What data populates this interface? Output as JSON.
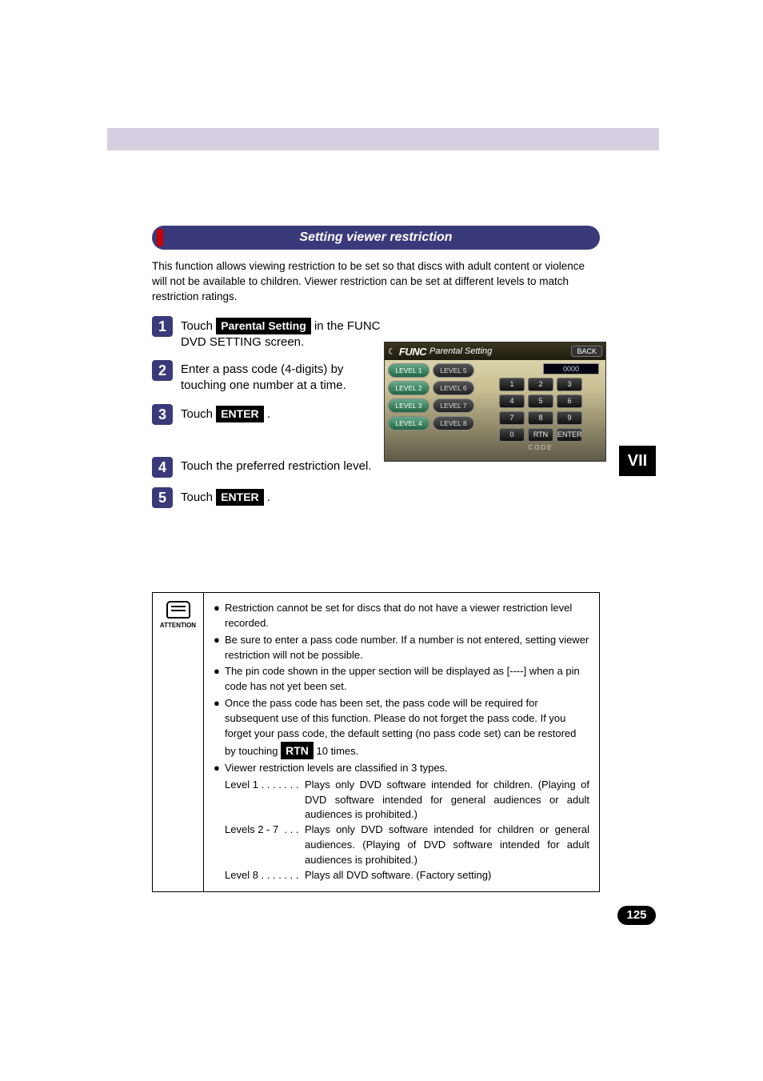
{
  "section_title": "Setting viewer restriction",
  "intro": "This function allows viewing restriction to be set so that discs with adult content or violence will not be available to children. Viewer restriction can be set at different levels to match restriction ratings.",
  "steps": {
    "s1_pre": "Touch ",
    "s1_btn": "Parental Setting",
    "s1_post": " in the FUNC DVD SETTING screen.",
    "s2": "Enter a pass code (4-digits) by touching one number at a time.",
    "s3_pre": "Touch ",
    "s3_btn": "ENTER",
    "s3_post": " .",
    "s4": "Touch the preferred restriction level.",
    "s5_pre": "Touch ",
    "s5_btn": "ENTER",
    "s5_post": " ."
  },
  "ui": {
    "func": "FUNC",
    "title": "Parental Setting",
    "back": "BACK",
    "code_value": "0000",
    "levels_a": [
      "LEVEL 1",
      "LEVEL 2",
      "LEVEL 3",
      "LEVEL 4"
    ],
    "levels_b": [
      "LEVEL 5",
      "LEVEL 6",
      "LEVEL 7",
      "LEVEL 8"
    ],
    "keys": [
      "1",
      "2",
      "3",
      "4",
      "5",
      "6",
      "7",
      "8",
      "9",
      "0",
      "RTN",
      "ENTER"
    ],
    "code_label": "CODE"
  },
  "side_tab": "VII",
  "attention_label": "ATTENTION",
  "attention": {
    "b1": "Restriction cannot be set for discs that do not have a viewer restriction level recorded.",
    "b2": "Be sure to enter a pass code number. If a number is not entered, setting viewer restriction will not be possible.",
    "b3": "The pin code shown in the upper section will be displayed as [----] when a pin code has not yet been set.",
    "b4_pre": "Once the pass code has been set, the pass code will be required for subsequent use of this function. Please do not forget the pass code. If you forget your pass code, the default setting (no pass code set) can be restored by touching ",
    "b4_btn": "RTN",
    "b4_post": " 10 times.",
    "b5": "Viewer restriction levels are classified in 3 types.",
    "l1_label": "Level 1 . . . . . . .",
    "l1_desc": "Plays only DVD software intended for children. (Playing of DVD software intended for general audiences or adult audiences is prohibited.)",
    "l2_label": "Levels 2 - 7  . . .",
    "l2_desc": "Plays only DVD software intended for children or general audiences. (Playing of DVD software intended for adult audiences is prohibited.)",
    "l3_label": "Level 8 . . . . . . .",
    "l3_desc": "Plays all DVD software. (Factory setting)"
  },
  "page_number": "125"
}
